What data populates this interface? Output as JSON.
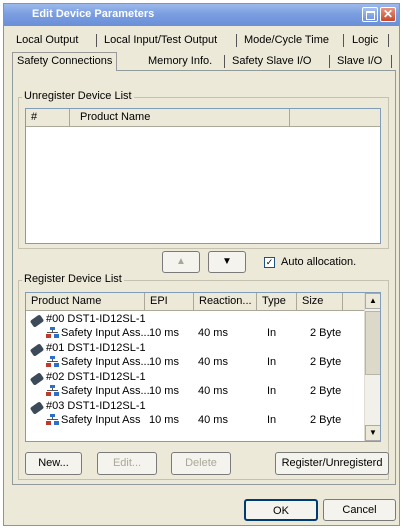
{
  "window": {
    "title": "Edit Device Parameters",
    "close_glyph": "✕"
  },
  "tabs": {
    "row1": [
      "Local Output",
      "Local Input/Test Output",
      "Mode/Cycle Time",
      "Logic"
    ],
    "row2": [
      "Safety Connections",
      "Memory Info.",
      "Safety Slave I/O",
      "Slave I/O"
    ],
    "active": "Safety Connections"
  },
  "unregister": {
    "group_label": "Unregister Device List",
    "columns": [
      "#",
      "Product Name"
    ]
  },
  "move_controls": {
    "up_glyph": "▲",
    "down_glyph": "▼"
  },
  "auto_allocation": {
    "label": "Auto allocation.",
    "checked": true,
    "check_glyph": "✓"
  },
  "register": {
    "group_label": "Register Device List",
    "columns": [
      "Product Name",
      "EPI",
      "Reaction...",
      "Type",
      "Size"
    ],
    "devices": [
      {
        "name": "#00 DST1-ID12SL-1",
        "child": "Safety Input Ass...",
        "epi": "10 ms",
        "reaction": "40 ms",
        "type": "In",
        "size": "2 Byte"
      },
      {
        "name": "#01 DST1-ID12SL-1",
        "child": "Safety Input Ass...",
        "epi": "10 ms",
        "reaction": "40 ms",
        "type": "In",
        "size": "2 Byte"
      },
      {
        "name": "#02 DST1-ID12SL-1",
        "child": "Safety Input Ass...",
        "epi": "10 ms",
        "reaction": "40 ms",
        "type": "In",
        "size": "2 Byte"
      },
      {
        "name": "#03 DST1-ID12SL-1",
        "child": "Safety Input Ass",
        "epi": "10 ms",
        "reaction": "40 ms",
        "type": "In",
        "size": "2 Byte"
      }
    ],
    "scroll_up": "▲",
    "scroll_down": "▼"
  },
  "buttons": {
    "new": "New...",
    "edit": "Edit...",
    "delete": "Delete",
    "register_toggle": "Register/Unregisterd",
    "ok": "OK",
    "cancel": "Cancel"
  }
}
